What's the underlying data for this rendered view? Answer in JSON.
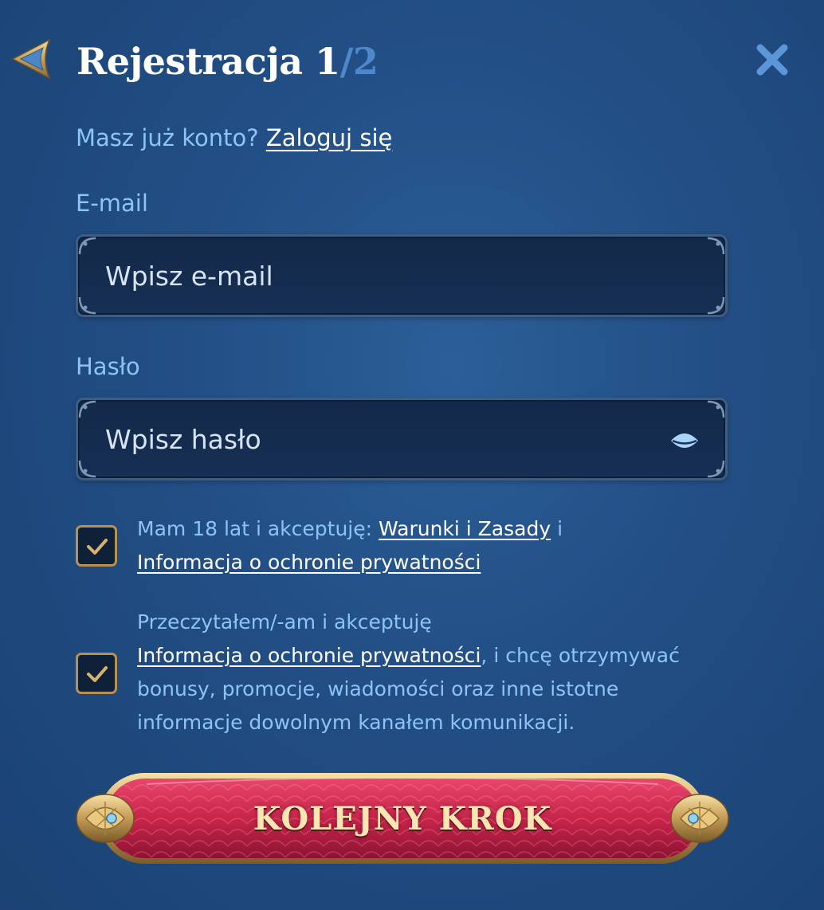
{
  "header": {
    "title": "Rejestracja 1",
    "step_total": "/2",
    "back_icon": "back-arrow-icon",
    "close_icon": "close-icon"
  },
  "login": {
    "prompt": "Masz już konto? ",
    "link": "Zaloguj się"
  },
  "form": {
    "email": {
      "label": "E-mail",
      "placeholder": "Wpisz e-mail",
      "value": ""
    },
    "password": {
      "label": "Hasło",
      "placeholder": "Wpisz hasło",
      "value": "",
      "toggle_icon": "eye-icon"
    }
  },
  "consents": [
    {
      "checked": true,
      "text_before": "Mam 18 lat i akceptuję: ",
      "link_1": "Warunki i Zasady",
      "text_mid": " i",
      "link_2": "Informacja o ochronie prywatności"
    },
    {
      "checked": true,
      "text_before": "Przeczytałem/-am i akceptuję",
      "link": "Informacja o ochronie prywatności",
      "text_after": ", i chcę otrzymywać bonusy, promocje, wiadomości oraz inne istotne informacje dowolnym kanałem komunikacji."
    }
  ],
  "next_button": {
    "label": "KOLEJNY KROK"
  },
  "colors": {
    "background": "#224f86",
    "label_blue": "#8cc4f4",
    "accent_blue": "#4d88cc",
    "gold": "#c9a15a",
    "button_red": "#c8254a"
  }
}
